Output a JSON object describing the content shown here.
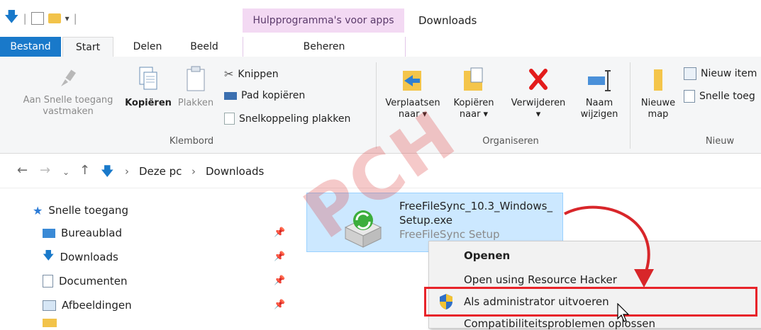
{
  "titlebar": {
    "context_tab": "Hulpprogramma's voor apps",
    "title": "Downloads"
  },
  "tabs": {
    "bestand": "Bestand",
    "start": "Start",
    "delen": "Delen",
    "beeld": "Beeld",
    "beheren": "Beheren"
  },
  "ribbon": {
    "pin_l1": "Aan Snelle toegang",
    "pin_l2": "vastmaken",
    "copy": "Kopiëren",
    "paste": "Plakken",
    "cut": "Knippen",
    "copy_path": "Pad kopiëren",
    "paste_shortcut": "Snelkoppeling plakken",
    "group_clipboard": "Klembord",
    "move_l1": "Verplaatsen",
    "move_l2": "naar ▾",
    "copyto_l1": "Kopiëren",
    "copyto_l2": "naar ▾",
    "delete_l1": "Verwijderen",
    "delete_l2": "▾",
    "rename_l1": "Naam",
    "rename_l2": "wijzigen",
    "group_organize": "Organiseren",
    "newfolder_l1": "Nieuwe",
    "newfolder_l2": "map",
    "new_item": "Nieuw item",
    "quick_access": "Snelle toeg",
    "group_new": "Nieuw"
  },
  "address": {
    "crumb1": "Deze pc",
    "crumb2": "Downloads",
    "sep": "›"
  },
  "navpane": {
    "items": [
      {
        "label": "Snelle toegang"
      },
      {
        "label": "Bureaublad"
      },
      {
        "label": "Downloads"
      },
      {
        "label": "Documenten"
      },
      {
        "label": "Afbeeldingen"
      }
    ]
  },
  "file": {
    "name_line1": "FreeFileSync_10.3_Windows_",
    "name_line2": "Setup.exe",
    "description": "FreeFileSync Setup"
  },
  "context_menu": {
    "items": [
      {
        "label": "Openen"
      },
      {
        "label": "Open using Resource Hacker"
      },
      {
        "label": "Als administrator uitvoeren"
      },
      {
        "label": "Compatibiliteitsproblemen oplossen"
      }
    ]
  },
  "watermark": "PCH",
  "colors": {
    "accent": "#1979ca",
    "context_tab": "#f3d9f3",
    "selection": "#cce8ff",
    "highlight_border": "#e8242a"
  }
}
